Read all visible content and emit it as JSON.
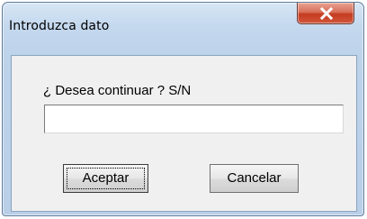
{
  "window": {
    "title": "Introduzca dato",
    "close_icon": "close-icon"
  },
  "dialog": {
    "prompt": "¿ Desea continuar ? S/N",
    "input_value": "",
    "buttons": {
      "accept_label": "Aceptar",
      "cancel_label": "Cancelar"
    }
  },
  "colors": {
    "title_bar": "#c4d8ee",
    "close_button": "#c43b21",
    "client_background": "#f0f0f0"
  }
}
